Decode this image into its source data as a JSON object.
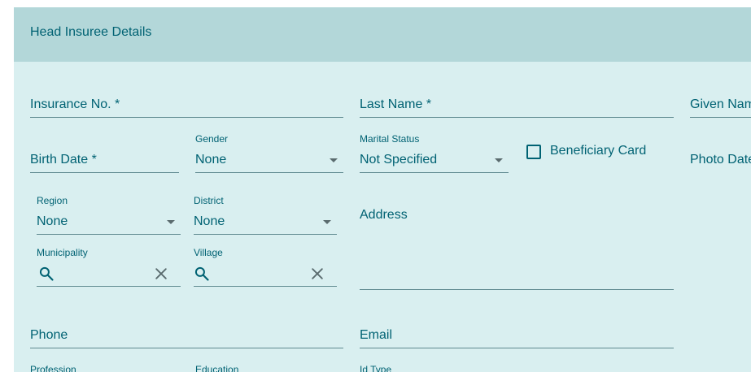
{
  "panel": {
    "title": "Head Insuree Details"
  },
  "fields": {
    "insurance_no": {
      "label": "Insurance No. *"
    },
    "last_name": {
      "label": "Last Name *"
    },
    "given_name": {
      "label": "Given Nam"
    },
    "birth_date": {
      "label": "Birth Date *"
    },
    "gender": {
      "label": "Gender",
      "value": "None"
    },
    "marital_status": {
      "label": "Marital Status",
      "value": "Not Specified"
    },
    "beneficiary_card": {
      "label": "Beneficiary Card",
      "checked": false
    },
    "photo_date": {
      "label": "Photo Date"
    },
    "region": {
      "label": "Region",
      "value": "None"
    },
    "district": {
      "label": "District",
      "value": "None"
    },
    "address": {
      "label": "Address"
    },
    "municipality": {
      "label": "Municipality"
    },
    "village": {
      "label": "Village"
    },
    "phone": {
      "label": "Phone"
    },
    "email": {
      "label": "Email"
    },
    "profession": {
      "label": "Profession"
    },
    "education": {
      "label": "Education"
    },
    "id_type": {
      "label": "Id Type"
    }
  },
  "icons": {
    "search": "search-icon",
    "clear": "close-icon",
    "dropdown": "chevron-down-icon"
  },
  "colors": {
    "header_bg": "#b3d7d9",
    "panel_bg": "#d9eff0",
    "text": "#006273"
  }
}
